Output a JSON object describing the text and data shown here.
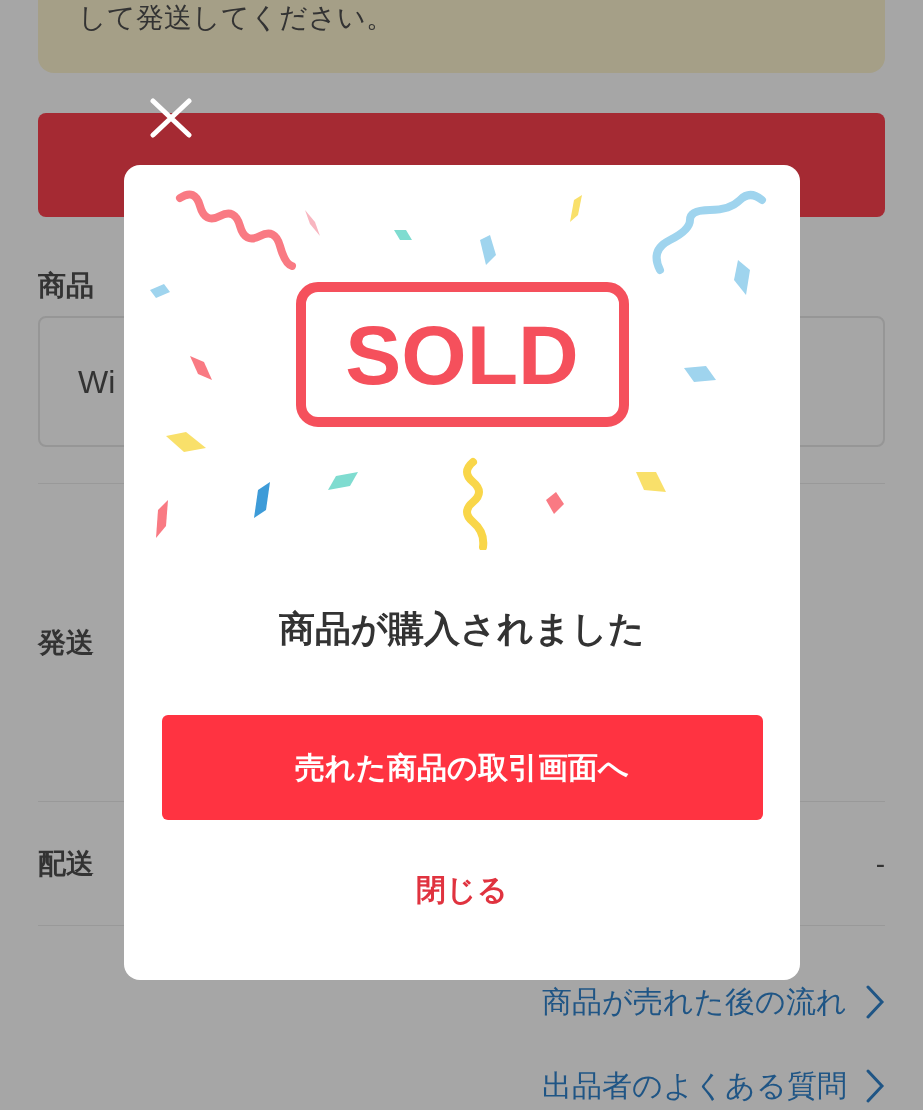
{
  "background": {
    "notice": "して発送してください。",
    "rows": [
      {
        "kind": "field",
        "label": "商品",
        "value": "Wi"
      },
      {
        "kind": "plain",
        "label": "発送"
      },
      {
        "kind": "value",
        "label": "配送",
        "value": "-"
      }
    ],
    "links": [
      "商品が売れた後の流れ",
      "出品者のよくある質問"
    ]
  },
  "modal": {
    "stamp": "SOLD",
    "title": "商品が購入されました",
    "primary_button": "売れた商品の取引画面へ",
    "close_link": "閉じる"
  }
}
